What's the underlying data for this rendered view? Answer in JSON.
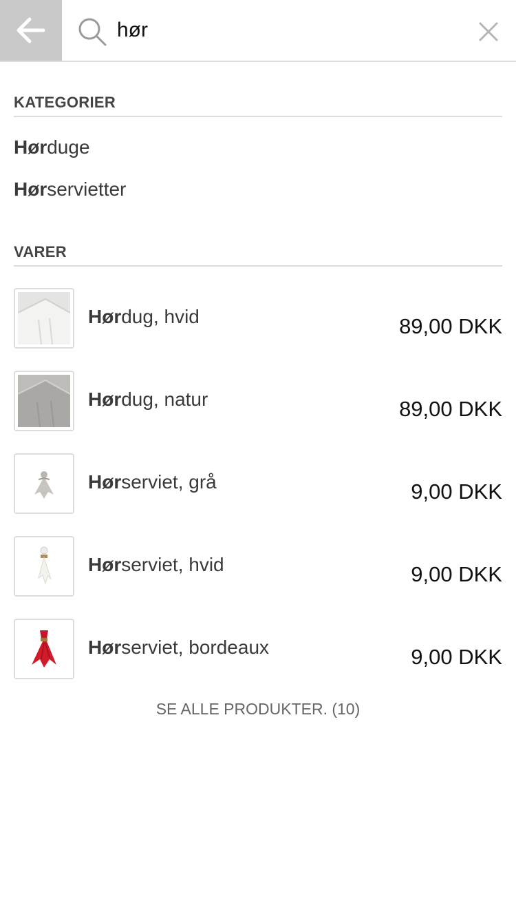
{
  "search": {
    "query": "hør",
    "icon_back": "arrow-left-icon",
    "icon_search": "search-icon",
    "icon_clear": "close-icon"
  },
  "categories": {
    "header": "KATEGORIER",
    "items": [
      {
        "match": "Hør",
        "rest": "duge"
      },
      {
        "match": "Hør",
        "rest": "servietter"
      }
    ]
  },
  "products": {
    "header": "VARER",
    "items": [
      {
        "match": "Hør",
        "rest": "dug, hvid",
        "price": "89,00 DKK",
        "image": "white-tablecloth"
      },
      {
        "match": "Hør",
        "rest": "dug, natur",
        "price": "89,00 DKK",
        "image": "natural-tablecloth"
      },
      {
        "match": "Hør",
        "rest": "serviet, grå",
        "price": "9,00 DKK",
        "image": "grey-napkin"
      },
      {
        "match": "Hør",
        "rest": "serviet, hvid",
        "price": "9,00 DKK",
        "image": "white-napkin"
      },
      {
        "match": "Hør",
        "rest": "serviet, bordeaux",
        "price": "9,00 DKK",
        "image": "bordeaux-napkin"
      }
    ]
  },
  "see_all": "SE ALLE PRODUKTER. (10)",
  "colors": {
    "back_button_bg": "#c9c9c9",
    "divider": "#dcdcdc",
    "text": "#3a3a3a",
    "bordeaux": "#d11a2a"
  }
}
